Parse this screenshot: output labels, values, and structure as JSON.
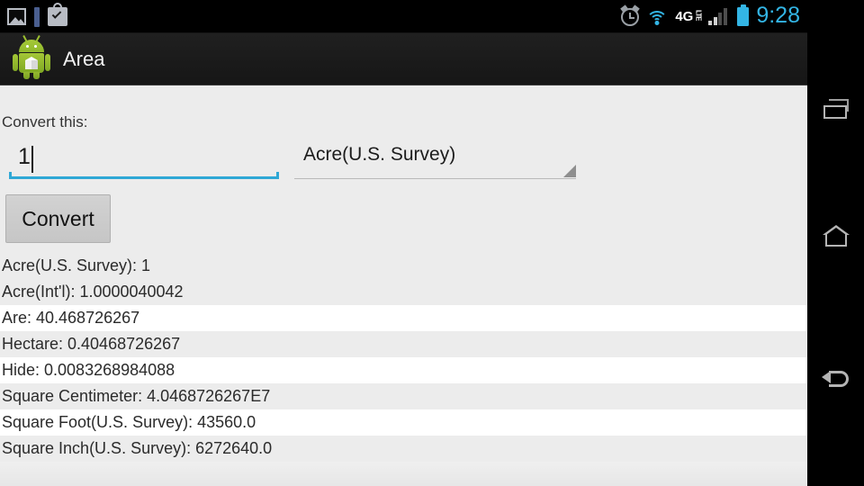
{
  "statusbar": {
    "time": "9:28",
    "network_label": "4G",
    "network_sub": "LTE",
    "left_icons": [
      "photo-icon",
      "bookmark-bar-icon",
      "shopping-bag-check-icon"
    ],
    "right_icons": [
      "alarm-icon",
      "wifi-icon",
      "4g-lte-icon",
      "signal-bars-icon",
      "battery-icon"
    ],
    "accent_color": "#33b5e5"
  },
  "actionbar": {
    "title": "Area",
    "app_icon": "android-robot-cube-icon"
  },
  "form": {
    "convert_label": "Convert this:",
    "input_value": "1",
    "input_placeholder": "",
    "input_underline_color": "#2fa8d6",
    "spinner_value": "Acre(U.S. Survey)",
    "convert_button": "Convert"
  },
  "results": [
    "Acre(U.S. Survey): 1",
    "Acre(Int'l): 1.0000040042",
    "Are: 40.468726267",
    "Hectare: 0.40468726267",
    "Hide: 0.0083268984088",
    "Square Centimeter: 4.0468726267E7",
    "Square Foot(U.S. Survey): 43560.0",
    "Square Inch(U.S. Survey): 6272640.0"
  ],
  "navbar": {
    "recent_label": "Recent apps",
    "home_label": "Home",
    "back_label": "Back"
  }
}
